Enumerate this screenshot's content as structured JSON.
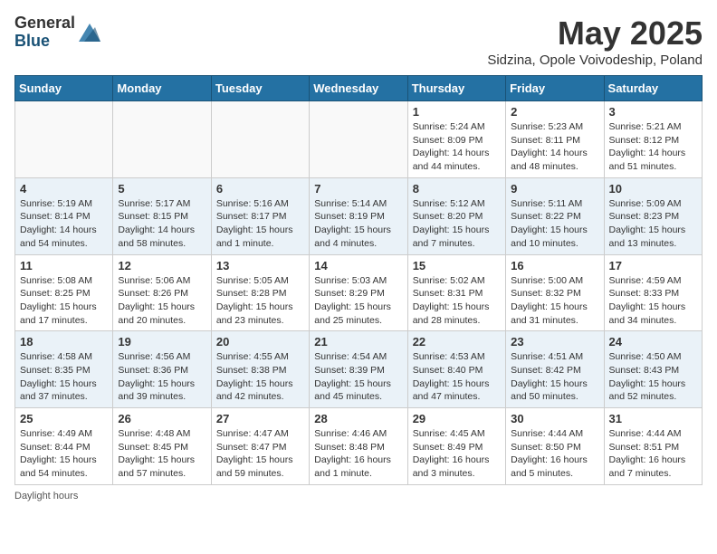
{
  "header": {
    "logo_general": "General",
    "logo_blue": "Blue",
    "month": "May 2025",
    "location": "Sidzina, Opole Voivodeship, Poland"
  },
  "weekdays": [
    "Sunday",
    "Monday",
    "Tuesday",
    "Wednesday",
    "Thursday",
    "Friday",
    "Saturday"
  ],
  "weeks": [
    [
      {
        "day": "",
        "info": ""
      },
      {
        "day": "",
        "info": ""
      },
      {
        "day": "",
        "info": ""
      },
      {
        "day": "",
        "info": ""
      },
      {
        "day": "1",
        "info": "Sunrise: 5:24 AM\nSunset: 8:09 PM\nDaylight: 14 hours\nand 44 minutes."
      },
      {
        "day": "2",
        "info": "Sunrise: 5:23 AM\nSunset: 8:11 PM\nDaylight: 14 hours\nand 48 minutes."
      },
      {
        "day": "3",
        "info": "Sunrise: 5:21 AM\nSunset: 8:12 PM\nDaylight: 14 hours\nand 51 minutes."
      }
    ],
    [
      {
        "day": "4",
        "info": "Sunrise: 5:19 AM\nSunset: 8:14 PM\nDaylight: 14 hours\nand 54 minutes."
      },
      {
        "day": "5",
        "info": "Sunrise: 5:17 AM\nSunset: 8:15 PM\nDaylight: 14 hours\nand 58 minutes."
      },
      {
        "day": "6",
        "info": "Sunrise: 5:16 AM\nSunset: 8:17 PM\nDaylight: 15 hours\nand 1 minute."
      },
      {
        "day": "7",
        "info": "Sunrise: 5:14 AM\nSunset: 8:19 PM\nDaylight: 15 hours\nand 4 minutes."
      },
      {
        "day": "8",
        "info": "Sunrise: 5:12 AM\nSunset: 8:20 PM\nDaylight: 15 hours\nand 7 minutes."
      },
      {
        "day": "9",
        "info": "Sunrise: 5:11 AM\nSunset: 8:22 PM\nDaylight: 15 hours\nand 10 minutes."
      },
      {
        "day": "10",
        "info": "Sunrise: 5:09 AM\nSunset: 8:23 PM\nDaylight: 15 hours\nand 13 minutes."
      }
    ],
    [
      {
        "day": "11",
        "info": "Sunrise: 5:08 AM\nSunset: 8:25 PM\nDaylight: 15 hours\nand 17 minutes."
      },
      {
        "day": "12",
        "info": "Sunrise: 5:06 AM\nSunset: 8:26 PM\nDaylight: 15 hours\nand 20 minutes."
      },
      {
        "day": "13",
        "info": "Sunrise: 5:05 AM\nSunset: 8:28 PM\nDaylight: 15 hours\nand 23 minutes."
      },
      {
        "day": "14",
        "info": "Sunrise: 5:03 AM\nSunset: 8:29 PM\nDaylight: 15 hours\nand 25 minutes."
      },
      {
        "day": "15",
        "info": "Sunrise: 5:02 AM\nSunset: 8:31 PM\nDaylight: 15 hours\nand 28 minutes."
      },
      {
        "day": "16",
        "info": "Sunrise: 5:00 AM\nSunset: 8:32 PM\nDaylight: 15 hours\nand 31 minutes."
      },
      {
        "day": "17",
        "info": "Sunrise: 4:59 AM\nSunset: 8:33 PM\nDaylight: 15 hours\nand 34 minutes."
      }
    ],
    [
      {
        "day": "18",
        "info": "Sunrise: 4:58 AM\nSunset: 8:35 PM\nDaylight: 15 hours\nand 37 minutes."
      },
      {
        "day": "19",
        "info": "Sunrise: 4:56 AM\nSunset: 8:36 PM\nDaylight: 15 hours\nand 39 minutes."
      },
      {
        "day": "20",
        "info": "Sunrise: 4:55 AM\nSunset: 8:38 PM\nDaylight: 15 hours\nand 42 minutes."
      },
      {
        "day": "21",
        "info": "Sunrise: 4:54 AM\nSunset: 8:39 PM\nDaylight: 15 hours\nand 45 minutes."
      },
      {
        "day": "22",
        "info": "Sunrise: 4:53 AM\nSunset: 8:40 PM\nDaylight: 15 hours\nand 47 minutes."
      },
      {
        "day": "23",
        "info": "Sunrise: 4:51 AM\nSunset: 8:42 PM\nDaylight: 15 hours\nand 50 minutes."
      },
      {
        "day": "24",
        "info": "Sunrise: 4:50 AM\nSunset: 8:43 PM\nDaylight: 15 hours\nand 52 minutes."
      }
    ],
    [
      {
        "day": "25",
        "info": "Sunrise: 4:49 AM\nSunset: 8:44 PM\nDaylight: 15 hours\nand 54 minutes."
      },
      {
        "day": "26",
        "info": "Sunrise: 4:48 AM\nSunset: 8:45 PM\nDaylight: 15 hours\nand 57 minutes."
      },
      {
        "day": "27",
        "info": "Sunrise: 4:47 AM\nSunset: 8:47 PM\nDaylight: 15 hours\nand 59 minutes."
      },
      {
        "day": "28",
        "info": "Sunrise: 4:46 AM\nSunset: 8:48 PM\nDaylight: 16 hours\nand 1 minute."
      },
      {
        "day": "29",
        "info": "Sunrise: 4:45 AM\nSunset: 8:49 PM\nDaylight: 16 hours\nand 3 minutes."
      },
      {
        "day": "30",
        "info": "Sunrise: 4:44 AM\nSunset: 8:50 PM\nDaylight: 16 hours\nand 5 minutes."
      },
      {
        "day": "31",
        "info": "Sunrise: 4:44 AM\nSunset: 8:51 PM\nDaylight: 16 hours\nand 7 minutes."
      }
    ]
  ],
  "footer": "Daylight hours"
}
